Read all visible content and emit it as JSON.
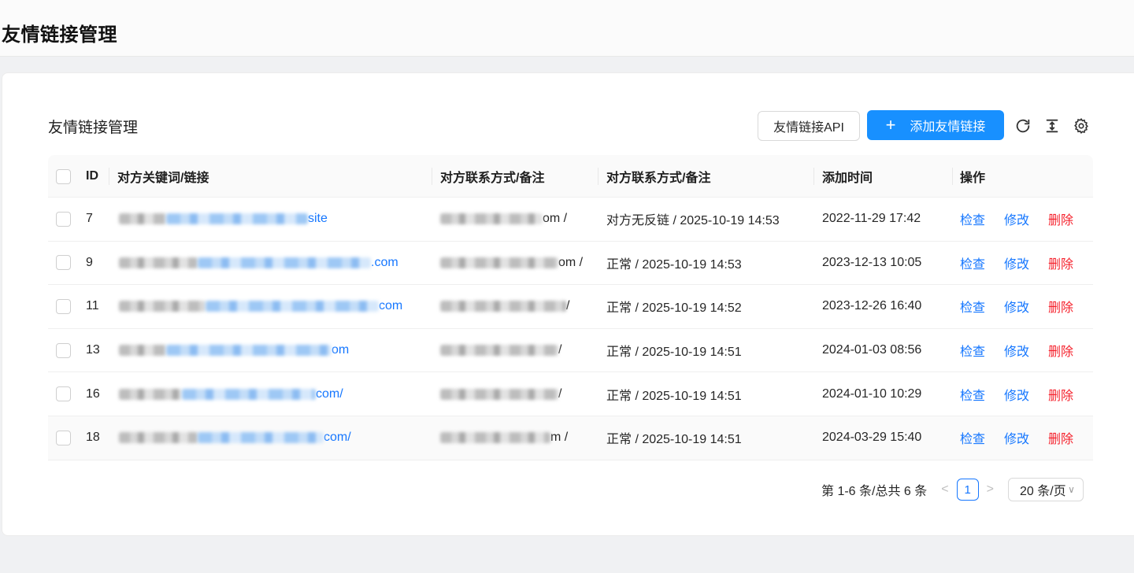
{
  "page": {
    "title": "友情链接管理"
  },
  "card": {
    "title": "友情链接管理",
    "api_button": "友情链接API",
    "add_button": "添加友情链接",
    "accent_color": "#1890ff",
    "danger_color": "#f5222d"
  },
  "toolbar_icons": [
    "reload-icon",
    "column-height-icon",
    "setting-icon"
  ],
  "table": {
    "columns": [
      "ID",
      "对方关键词/链接",
      "对方联系方式/备注",
      "对方联系方式/备注",
      "添加时间",
      "操作"
    ],
    "rows": [
      {
        "id": "7",
        "link_suffix": "site",
        "contact_suffix": "om /",
        "status": "对方无反链 / 2025-10-19 14:53",
        "added": "2022-11-29 17:42"
      },
      {
        "id": "9",
        "link_suffix": ".com",
        "contact_suffix": "om /",
        "status": "正常 / 2025-10-19 14:53",
        "added": "2023-12-13 10:05"
      },
      {
        "id": "11",
        "link_suffix": "com",
        "contact_suffix": "/",
        "status": "正常 / 2025-10-19 14:52",
        "added": "2023-12-26 16:40"
      },
      {
        "id": "13",
        "link_suffix": "om",
        "contact_suffix": "/",
        "status": "正常 / 2025-10-19 14:51",
        "added": "2024-01-03 08:56"
      },
      {
        "id": "16",
        "link_suffix": "com/",
        "contact_suffix": "/",
        "status": "正常 / 2025-10-19 14:51",
        "added": "2024-01-10 10:29"
      },
      {
        "id": "18",
        "link_suffix": "com/",
        "contact_suffix": "m /",
        "status": "正常 / 2025-10-19 14:51",
        "added": "2024-03-29 15:40"
      }
    ],
    "actions": {
      "check": "检查",
      "edit": "修改",
      "delete": "删除"
    }
  },
  "pagination": {
    "summary": "第 1-6 条/总共 6 条",
    "prev": "<",
    "next": ">",
    "current_page": "1",
    "page_size": "20 条/页"
  }
}
